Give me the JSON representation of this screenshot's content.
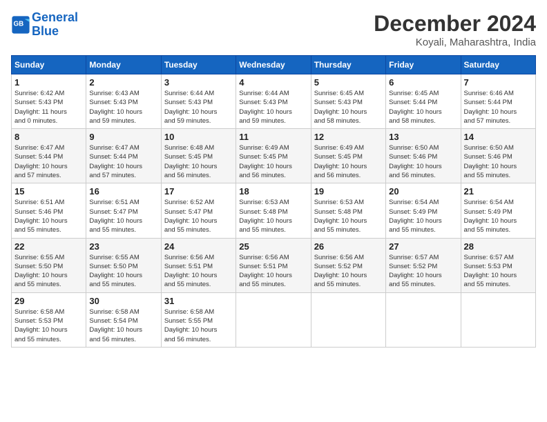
{
  "header": {
    "logo_line1": "General",
    "logo_line2": "Blue",
    "month_title": "December 2024",
    "location": "Koyali, Maharashtra, India"
  },
  "days_of_week": [
    "Sunday",
    "Monday",
    "Tuesday",
    "Wednesday",
    "Thursday",
    "Friday",
    "Saturday"
  ],
  "weeks": [
    [
      {
        "day": "1",
        "info": "Sunrise: 6:42 AM\nSunset: 5:43 PM\nDaylight: 11 hours\nand 0 minutes."
      },
      {
        "day": "2",
        "info": "Sunrise: 6:43 AM\nSunset: 5:43 PM\nDaylight: 10 hours\nand 59 minutes."
      },
      {
        "day": "3",
        "info": "Sunrise: 6:44 AM\nSunset: 5:43 PM\nDaylight: 10 hours\nand 59 minutes."
      },
      {
        "day": "4",
        "info": "Sunrise: 6:44 AM\nSunset: 5:43 PM\nDaylight: 10 hours\nand 59 minutes."
      },
      {
        "day": "5",
        "info": "Sunrise: 6:45 AM\nSunset: 5:43 PM\nDaylight: 10 hours\nand 58 minutes."
      },
      {
        "day": "6",
        "info": "Sunrise: 6:45 AM\nSunset: 5:44 PM\nDaylight: 10 hours\nand 58 minutes."
      },
      {
        "day": "7",
        "info": "Sunrise: 6:46 AM\nSunset: 5:44 PM\nDaylight: 10 hours\nand 57 minutes."
      }
    ],
    [
      {
        "day": "8",
        "info": "Sunrise: 6:47 AM\nSunset: 5:44 PM\nDaylight: 10 hours\nand 57 minutes."
      },
      {
        "day": "9",
        "info": "Sunrise: 6:47 AM\nSunset: 5:44 PM\nDaylight: 10 hours\nand 57 minutes."
      },
      {
        "day": "10",
        "info": "Sunrise: 6:48 AM\nSunset: 5:45 PM\nDaylight: 10 hours\nand 56 minutes."
      },
      {
        "day": "11",
        "info": "Sunrise: 6:49 AM\nSunset: 5:45 PM\nDaylight: 10 hours\nand 56 minutes."
      },
      {
        "day": "12",
        "info": "Sunrise: 6:49 AM\nSunset: 5:45 PM\nDaylight: 10 hours\nand 56 minutes."
      },
      {
        "day": "13",
        "info": "Sunrise: 6:50 AM\nSunset: 5:46 PM\nDaylight: 10 hours\nand 56 minutes."
      },
      {
        "day": "14",
        "info": "Sunrise: 6:50 AM\nSunset: 5:46 PM\nDaylight: 10 hours\nand 55 minutes."
      }
    ],
    [
      {
        "day": "15",
        "info": "Sunrise: 6:51 AM\nSunset: 5:46 PM\nDaylight: 10 hours\nand 55 minutes."
      },
      {
        "day": "16",
        "info": "Sunrise: 6:51 AM\nSunset: 5:47 PM\nDaylight: 10 hours\nand 55 minutes."
      },
      {
        "day": "17",
        "info": "Sunrise: 6:52 AM\nSunset: 5:47 PM\nDaylight: 10 hours\nand 55 minutes."
      },
      {
        "day": "18",
        "info": "Sunrise: 6:53 AM\nSunset: 5:48 PM\nDaylight: 10 hours\nand 55 minutes."
      },
      {
        "day": "19",
        "info": "Sunrise: 6:53 AM\nSunset: 5:48 PM\nDaylight: 10 hours\nand 55 minutes."
      },
      {
        "day": "20",
        "info": "Sunrise: 6:54 AM\nSunset: 5:49 PM\nDaylight: 10 hours\nand 55 minutes."
      },
      {
        "day": "21",
        "info": "Sunrise: 6:54 AM\nSunset: 5:49 PM\nDaylight: 10 hours\nand 55 minutes."
      }
    ],
    [
      {
        "day": "22",
        "info": "Sunrise: 6:55 AM\nSunset: 5:50 PM\nDaylight: 10 hours\nand 55 minutes."
      },
      {
        "day": "23",
        "info": "Sunrise: 6:55 AM\nSunset: 5:50 PM\nDaylight: 10 hours\nand 55 minutes."
      },
      {
        "day": "24",
        "info": "Sunrise: 6:56 AM\nSunset: 5:51 PM\nDaylight: 10 hours\nand 55 minutes."
      },
      {
        "day": "25",
        "info": "Sunrise: 6:56 AM\nSunset: 5:51 PM\nDaylight: 10 hours\nand 55 minutes."
      },
      {
        "day": "26",
        "info": "Sunrise: 6:56 AM\nSunset: 5:52 PM\nDaylight: 10 hours\nand 55 minutes."
      },
      {
        "day": "27",
        "info": "Sunrise: 6:57 AM\nSunset: 5:52 PM\nDaylight: 10 hours\nand 55 minutes."
      },
      {
        "day": "28",
        "info": "Sunrise: 6:57 AM\nSunset: 5:53 PM\nDaylight: 10 hours\nand 55 minutes."
      }
    ],
    [
      {
        "day": "29",
        "info": "Sunrise: 6:58 AM\nSunset: 5:53 PM\nDaylight: 10 hours\nand 55 minutes."
      },
      {
        "day": "30",
        "info": "Sunrise: 6:58 AM\nSunset: 5:54 PM\nDaylight: 10 hours\nand 56 minutes."
      },
      {
        "day": "31",
        "info": "Sunrise: 6:58 AM\nSunset: 5:55 PM\nDaylight: 10 hours\nand 56 minutes."
      },
      null,
      null,
      null,
      null
    ]
  ]
}
